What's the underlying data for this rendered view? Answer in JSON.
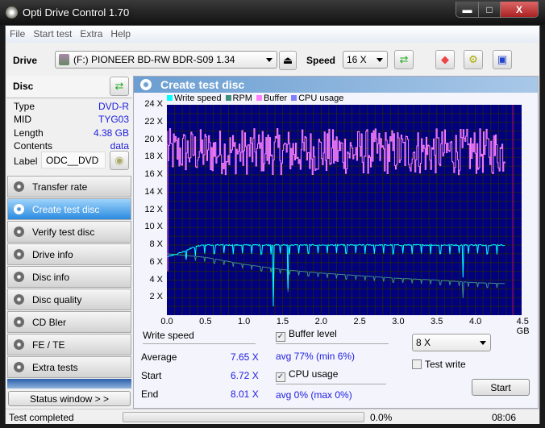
{
  "window": {
    "title": "Opti Drive Control 1.70",
    "min": "▬",
    "max": "□",
    "close": "X"
  },
  "menu": [
    "File",
    "Start test",
    "Extra",
    "Help"
  ],
  "toolbar": {
    "drive_label": "Drive",
    "drive_value": "(F:)   PIONEER BD-RW   BDR-S09 1.34",
    "speed_label": "Speed",
    "speed_value": "16 X"
  },
  "disc": {
    "title": "Disc",
    "type_k": "Type",
    "type_v": "DVD-R",
    "mid_k": "MID",
    "mid_v": "TYG03",
    "length_k": "Length",
    "length_v": "4.38 GB",
    "contents_k": "Contents",
    "contents_v": "data",
    "label_k": "Label",
    "label_v": "ODC__DVD"
  },
  "nav": [
    "Transfer rate",
    "Create test disc",
    "Verify test disc",
    "Drive info",
    "Disc info",
    "Disc quality",
    "CD Bler",
    "FE / TE",
    "Extra tests"
  ],
  "nav_active": 1,
  "status_window": "Status window > >",
  "panel": {
    "title": "Create test disc"
  },
  "chart_data": {
    "type": "line",
    "legend": [
      "Write speed",
      "RPM",
      "Buffer",
      "CPU usage"
    ],
    "colors": {
      "write": "#00ffff",
      "rpm": "#3f8f7f",
      "buffer": "#ff80ff",
      "cpu": "#8080ff",
      "bg": "#000080",
      "grid": "#202020",
      "end": "#b0008f"
    },
    "yticks": [
      "2 X",
      "4 X",
      "6 X",
      "8 X",
      "10 X",
      "12 X",
      "14 X",
      "16 X",
      "18 X",
      "20 X",
      "22 X",
      "24 X"
    ],
    "xticks": [
      "0.0",
      "0.5",
      "1.0",
      "1.5",
      "2.0",
      "2.5",
      "3.0",
      "3.5",
      "4.0",
      "4.5 GB"
    ],
    "ylim": [
      0,
      24
    ],
    "xlim": [
      0,
      4.6
    ],
    "write_speed": {
      "x": [
        0,
        0.1,
        0.2,
        0.3,
        0.45,
        1.38,
        1.57,
        3.84,
        4.38
      ],
      "y": [
        6.7,
        6.9,
        7.2,
        7.6,
        8.0,
        8.0,
        8.0,
        8.0,
        8.0
      ],
      "dips": [
        [
          1.38,
          1.0
        ],
        [
          1.57,
          3.0
        ],
        [
          3.84,
          4.3
        ]
      ]
    },
    "rpm": {
      "x": [
        0,
        0.5,
        1.0,
        1.5,
        2.0,
        2.5,
        3.0,
        3.5,
        4.0,
        4.38
      ],
      "y": [
        7.0,
        6.6,
        5.8,
        5.2,
        4.8,
        4.5,
        4.2,
        4.0,
        3.7,
        3.6
      ]
    },
    "buffer_range": [
      16,
      21
    ],
    "end_gb": 4.38
  },
  "results": {
    "write_speed": "Write speed",
    "avg_k": "Average",
    "avg_v": "7.65 X",
    "start_k": "Start",
    "start_v": "6.72 X",
    "end_k": "End",
    "end_v": "8.01 X",
    "buffer_label": "Buffer level",
    "buffer_stats": "avg 77% (min 6%)",
    "cpu_label": "CPU usage",
    "cpu_stats": "avg 0% (max 0%)",
    "write_speed_sel": "8 X",
    "test_write": "Test write",
    "start_btn": "Start"
  },
  "status": {
    "text": "Test completed",
    "progress": "0.0%",
    "progress_value": 0,
    "time": "08:06"
  }
}
